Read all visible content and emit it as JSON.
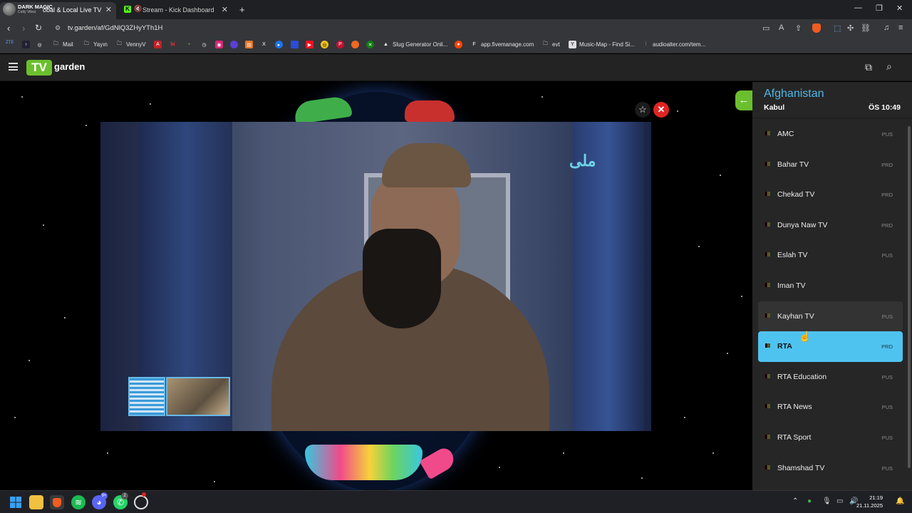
{
  "browser": {
    "profile": {
      "name": "DARK MAGIC",
      "subtitle": "Cutty Vibez"
    },
    "tabs": [
      {
        "title": "obal & Local Live TV",
        "active": true
      },
      {
        "title": "Stream - Kick Dashboard",
        "active": false
      }
    ],
    "url": "tv.garden/af/GdNlQ3ZHyYTh1H",
    "bookmarks": [
      {
        "label": "Mail",
        "icon": "folder-icon"
      },
      {
        "label": "Yayın",
        "icon": "folder-icon"
      },
      {
        "label": "VennyV",
        "icon": "folder-icon"
      },
      {
        "label": "Slug Generator Onli...",
        "icon": "slug-icon"
      },
      {
        "label": "app.fivemanage.com",
        "icon": "fivemanage-icon"
      },
      {
        "label": "evt",
        "icon": "folder-icon"
      },
      {
        "label": "Music-Map - Find Si...",
        "icon": "musicmap-icon"
      },
      {
        "label": "audioalter.com/tem...",
        "icon": "audioalter-icon"
      }
    ],
    "bookmark_extras": [
      "ZTE"
    ]
  },
  "site": {
    "logo_box": "TV",
    "logo_text": "garden"
  },
  "player": {
    "channel_logo_text": "ملی",
    "favorite_icon": "star-icon",
    "close_icon": "close-icon"
  },
  "panel": {
    "country": "Afghanistan",
    "capital": "Kabul",
    "local_time": "ÖS 10:49",
    "channels": [
      {
        "name": "AMC",
        "lang": "PUS",
        "state": "normal"
      },
      {
        "name": "Bahar TV",
        "lang": "PRD",
        "state": "normal"
      },
      {
        "name": "Chekad TV",
        "lang": "PRD",
        "state": "normal"
      },
      {
        "name": "Dunya Naw TV",
        "lang": "PRD",
        "state": "normal"
      },
      {
        "name": "Eslah TV",
        "lang": "PUS",
        "state": "normal"
      },
      {
        "name": "Iman TV",
        "lang": "",
        "state": "normal"
      },
      {
        "name": "Kayhan TV",
        "lang": "PUS",
        "state": "hover"
      },
      {
        "name": "RTA",
        "lang": "PRD",
        "state": "selected"
      },
      {
        "name": "RTA Education",
        "lang": "PUS",
        "state": "normal"
      },
      {
        "name": "RTA News",
        "lang": "PUS",
        "state": "normal"
      },
      {
        "name": "RTA Sport",
        "lang": "PUS",
        "state": "normal"
      },
      {
        "name": "Shamshad TV",
        "lang": "PUS",
        "state": "normal"
      }
    ]
  },
  "taskbar": {
    "time": "21:19",
    "date": "21.11.2025",
    "discord_badge": "9+",
    "whatsapp_badge": "2"
  },
  "colors": {
    "accent_green": "#6bbf2e",
    "country_blue": "#4fb8e8",
    "selected_bg": "#4fc3f0",
    "close_red": "#e02424"
  }
}
